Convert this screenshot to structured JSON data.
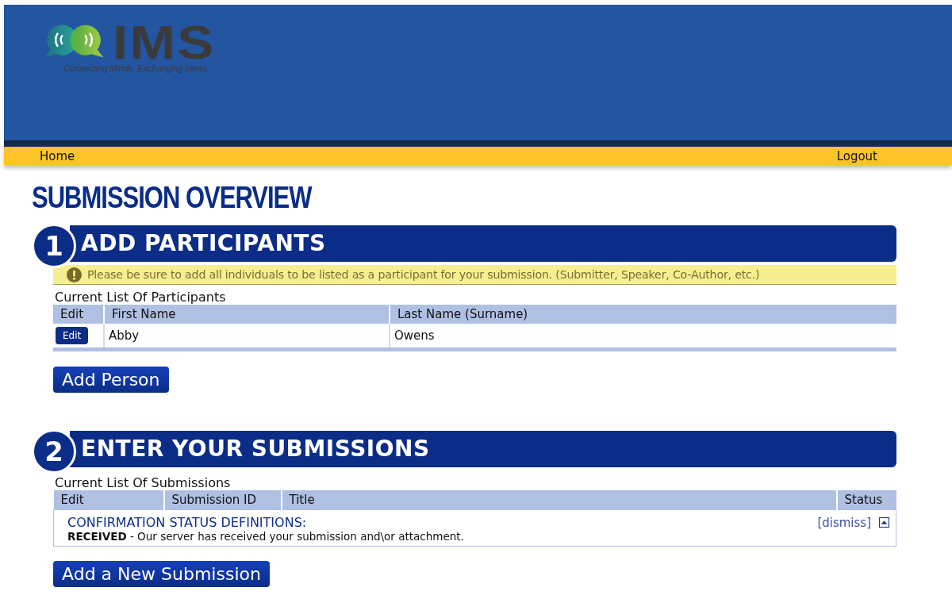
{
  "header": {
    "logo": {
      "wordmark": "IMS",
      "tagline": "Connecting Minds. Exchanging Ideas."
    }
  },
  "nav": [
    {
      "label": "Home"
    },
    {
      "label": "Logout"
    }
  ],
  "page_title": "SUBMISSION OVERVIEW",
  "sections": [
    {
      "number": "1",
      "title": "ADD PARTICIPANTS",
      "notice": "Please be sure to add all individuals to be listed as a participant for your submission. (Submitter, Speaker, Co-Author, etc.)",
      "list_title": "Current List Of Participants",
      "table": {
        "columns": [
          "Edit",
          "First Name",
          "Last Name (Surname)"
        ],
        "rows": [
          {
            "cells": [
              {
                "kind": "button",
                "text": "Edit"
              },
              {
                "kind": "text",
                "text": "Abby"
              },
              {
                "kind": "text",
                "text": "Owens"
              }
            ]
          }
        ]
      },
      "button": "Add Person"
    },
    {
      "number": "2",
      "title": "ENTER YOUR SUBMISSIONS",
      "list_title": "Current List Of Submissions",
      "table": {
        "columns": [
          "Edit",
          "Submission ID",
          "Title",
          "Status"
        ],
        "definitions": {
          "heading": "CONFIRMATION STATUS DEFINITIONS:",
          "dismiss": "[dismiss]",
          "items": [
            {
              "term": "RECEIVED",
              "description": " - Our server has received your submission and\\or attachment."
            }
          ]
        }
      },
      "button": "Add a New Submission"
    }
  ]
}
